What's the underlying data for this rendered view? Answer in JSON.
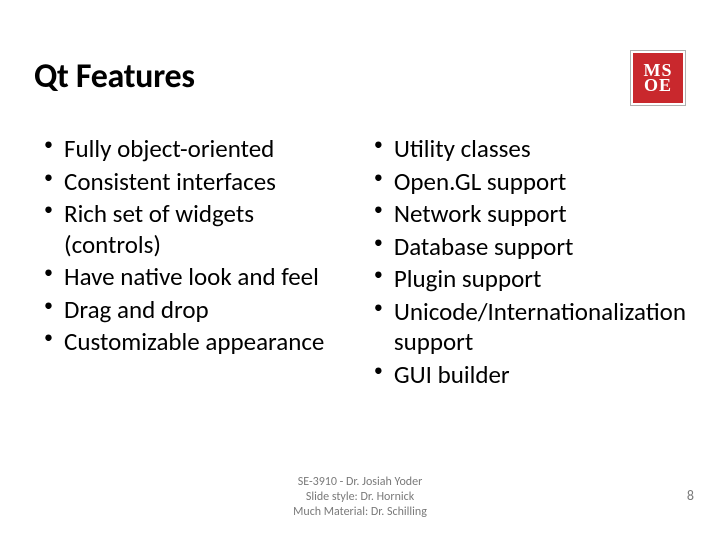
{
  "title": "Qt Features",
  "logo": {
    "row1": "MS",
    "row2": "OE"
  },
  "left_items": [
    "Fully object-oriented",
    "Consistent interfaces",
    "Rich set of widgets (controls)",
    "Have native look and feel",
    "Drag and drop",
    "Customizable appearance"
  ],
  "right_items": [
    "Utility classes",
    "Open.GL support",
    "Network support",
    "Database support",
    "Plugin support",
    "Unicode/Internationalization support",
    "GUI builder"
  ],
  "footer": {
    "line1": "SE-3910 - Dr. Josiah Yoder",
    "line2": "Slide style: Dr. Hornick",
    "line3": "Much Material: Dr. Schilling"
  },
  "page_number": "8"
}
